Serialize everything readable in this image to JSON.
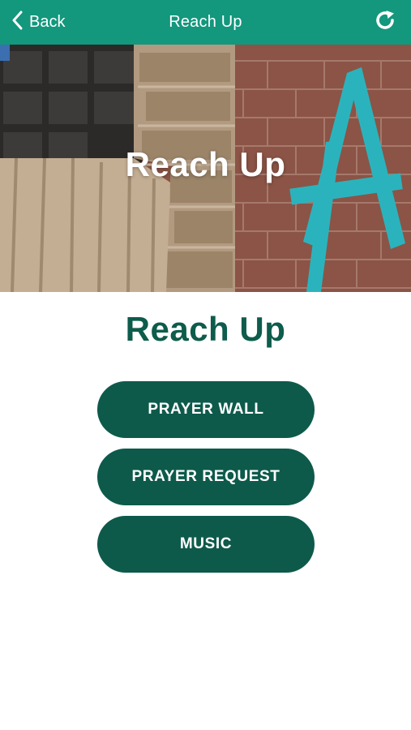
{
  "nav": {
    "back_label": "Back",
    "title": "Reach Up",
    "refresh_icon": "refresh-icon",
    "back_icon": "chevron-left-icon"
  },
  "hero": {
    "title": "Reach Up"
  },
  "page": {
    "heading": "Reach Up"
  },
  "buttons": {
    "prayer_wall": "PRAYER WALL",
    "prayer_request": "PRAYER REQUEST",
    "music": "MUSIC"
  },
  "colors": {
    "nav_bar": "#13977d",
    "heading": "#0d5c4c",
    "button": "#0d5a4b"
  }
}
